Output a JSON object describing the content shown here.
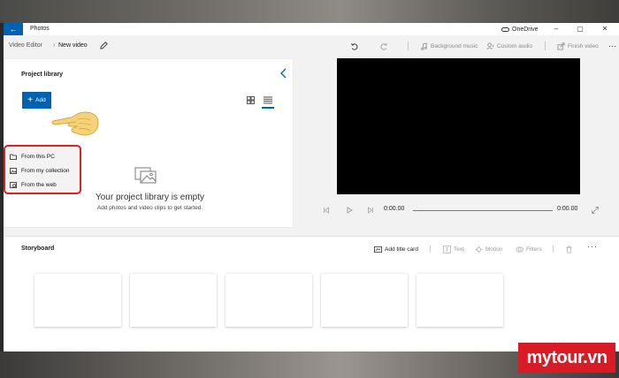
{
  "window": {
    "app_title": "Photos",
    "onedrive_label": "OneDrive"
  },
  "toolbar": {
    "breadcrumb_root": "Video Editor",
    "breadcrumb_sep": "›",
    "breadcrumb_current": "New video",
    "background_music": "Background music",
    "custom_audio": "Custom audio",
    "finish_video": "Finish video",
    "more": "···"
  },
  "library": {
    "title": "Project library",
    "add_label": "Add",
    "dropdown": [
      "From this PC",
      "From my collection",
      "From the web"
    ],
    "empty_title": "Your project library is empty",
    "empty_subtitle": "Add photos and video clips to get started."
  },
  "player": {
    "current_time": "0:00.00",
    "total_time": "0:00.00"
  },
  "storyboard": {
    "title": "Storyboard",
    "add_title_card": "Add title card",
    "text": "Text",
    "motion": "Motion",
    "filters": "Filters",
    "more": "···",
    "card_count": 5
  },
  "watermark": "mytour.vn",
  "colors": {
    "accent": "#0063b1",
    "highlight": "#e02020",
    "watermark_bg": "#d81b24"
  }
}
